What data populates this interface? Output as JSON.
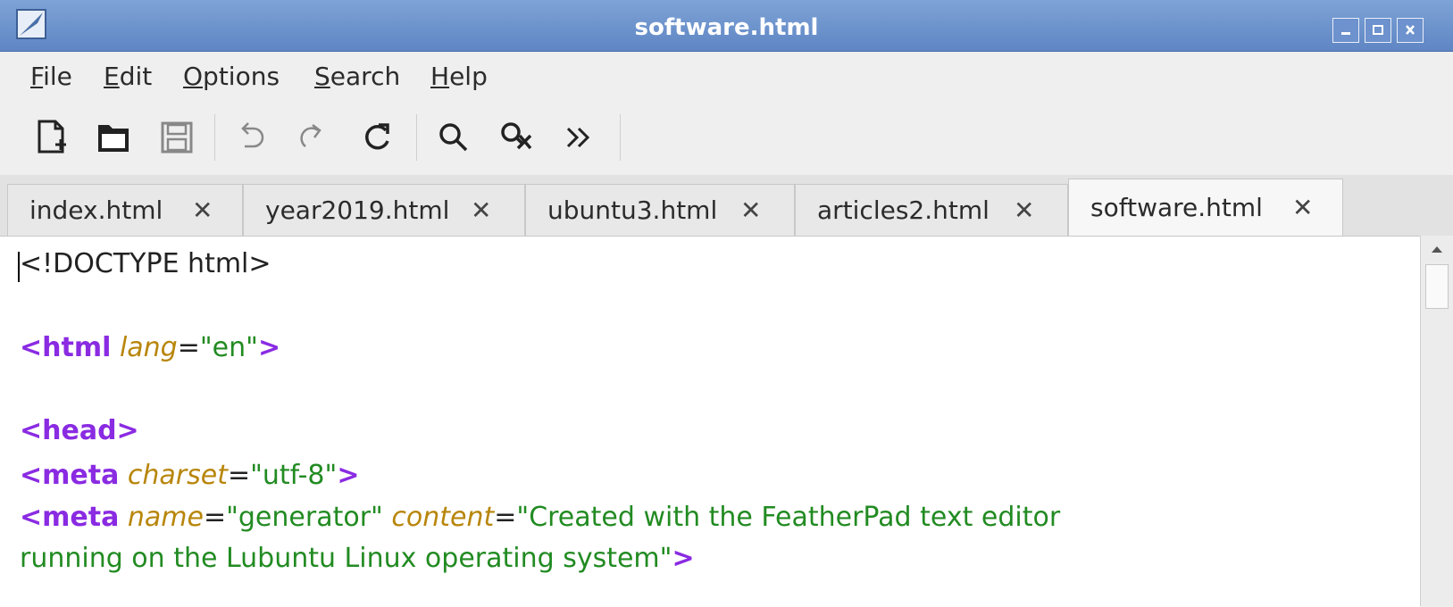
{
  "window": {
    "title": "software.html"
  },
  "menu": {
    "file": {
      "mnemonic": "F",
      "rest": "ile"
    },
    "edit": {
      "mnemonic": "E",
      "rest": "dit"
    },
    "options": {
      "mnemonic": "O",
      "rest": "ptions"
    },
    "search": {
      "mnemonic": "S",
      "rest": "earch"
    },
    "help": {
      "mnemonic": "H",
      "rest": "elp"
    }
  },
  "toolbar": {
    "icons": [
      "new-file-icon",
      "open-folder-icon",
      "save-icon",
      "undo-icon",
      "redo-icon",
      "reload-icon",
      "find-icon",
      "find-replace-icon",
      "more-icon"
    ]
  },
  "tabs": [
    {
      "label": "index.html",
      "close": "✕"
    },
    {
      "label": "year2019.html",
      "close": "✕"
    },
    {
      "label": "ubuntu3.html",
      "close": "✕"
    },
    {
      "label": "articles2.html",
      "close": "✕"
    },
    {
      "label": "software.html",
      "close": "✕",
      "active": true
    }
  ],
  "editor": {
    "line1": "<!DOCTYPE html>",
    "line2": {
      "tag_open": "<html",
      "attr": "lang",
      "eq": "=",
      "val": "\"en\"",
      "tag_close": ">"
    },
    "line3": {
      "tag": "<head>"
    },
    "line4": {
      "tag_open": "<meta",
      "attr": "charset",
      "eq": "=",
      "val": "\"utf-8\"",
      "tag_close": ">"
    },
    "line5": {
      "tag_open": "<meta",
      "attr1": "name",
      "eq1": "=",
      "val1": "\"generator\"",
      "attr2": "content",
      "eq2": "=",
      "val2a": "\"Created with the FeatherPad text editor"
    },
    "line6": {
      "val2b": "running on the Lubuntu Linux operating system\"",
      "tag_close": ">"
    }
  },
  "colors": {
    "titlebar": "#6b90cc",
    "tag": "#8a2be2",
    "attribute": "#b8860b",
    "string": "#228b22"
  }
}
